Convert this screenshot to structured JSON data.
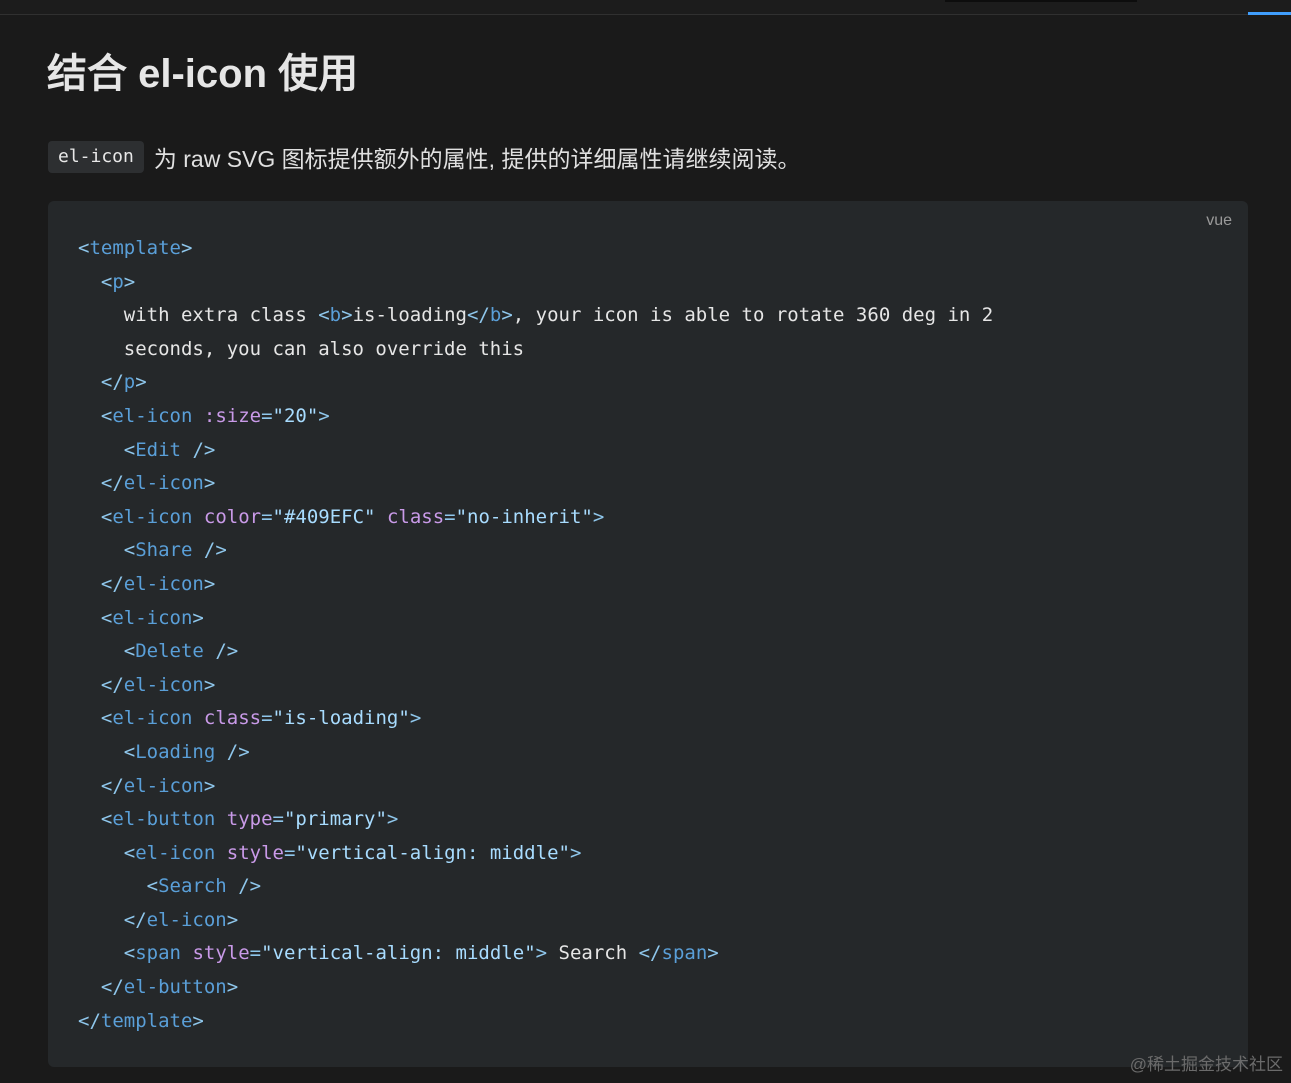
{
  "heading": "结合 el-icon 使用",
  "description": {
    "code": "el-icon",
    "text": "为 raw SVG 图标提供额外的属性, 提供的详细属性请继续阅读。"
  },
  "code_block": {
    "language": "vue",
    "lines": [
      [
        [
          "p",
          "<"
        ],
        [
          "t",
          "template"
        ],
        [
          "p",
          ">"
        ]
      ],
      [
        [
          "x",
          "  "
        ],
        [
          "p",
          "<"
        ],
        [
          "t",
          "p"
        ],
        [
          "p",
          ">"
        ]
      ],
      [
        [
          "x",
          "    with extra class "
        ],
        [
          "p",
          "<"
        ],
        [
          "t",
          "b"
        ],
        [
          "p",
          ">"
        ],
        [
          "x",
          "is-loading"
        ],
        [
          "p",
          "</"
        ],
        [
          "t",
          "b"
        ],
        [
          "p",
          ">"
        ],
        [
          "x",
          ", your icon is able to rotate 360 deg in 2"
        ]
      ],
      [
        [
          "x",
          "    seconds, you can also override this"
        ]
      ],
      [
        [
          "x",
          "  "
        ],
        [
          "p",
          "</"
        ],
        [
          "t",
          "p"
        ],
        [
          "p",
          ">"
        ]
      ],
      [
        [
          "x",
          "  "
        ],
        [
          "p",
          "<"
        ],
        [
          "t",
          "el-icon"
        ],
        [
          "x",
          " "
        ],
        [
          "a",
          ":size"
        ],
        [
          "p",
          "="
        ],
        [
          "s",
          "\"20\""
        ],
        [
          "p",
          ">"
        ]
      ],
      [
        [
          "x",
          "    "
        ],
        [
          "p",
          "<"
        ],
        [
          "t",
          "Edit"
        ],
        [
          "x",
          " "
        ],
        [
          "p",
          "/>"
        ]
      ],
      [
        [
          "x",
          "  "
        ],
        [
          "p",
          "</"
        ],
        [
          "t",
          "el-icon"
        ],
        [
          "p",
          ">"
        ]
      ],
      [
        [
          "x",
          "  "
        ],
        [
          "p",
          "<"
        ],
        [
          "t",
          "el-icon"
        ],
        [
          "x",
          " "
        ],
        [
          "a",
          "color"
        ],
        [
          "p",
          "="
        ],
        [
          "s",
          "\"#409EFC\""
        ],
        [
          "x",
          " "
        ],
        [
          "a",
          "class"
        ],
        [
          "p",
          "="
        ],
        [
          "s",
          "\"no-inherit\""
        ],
        [
          "p",
          ">"
        ]
      ],
      [
        [
          "x",
          "    "
        ],
        [
          "p",
          "<"
        ],
        [
          "t",
          "Share"
        ],
        [
          "x",
          " "
        ],
        [
          "p",
          "/>"
        ]
      ],
      [
        [
          "x",
          "  "
        ],
        [
          "p",
          "</"
        ],
        [
          "t",
          "el-icon"
        ],
        [
          "p",
          ">"
        ]
      ],
      [
        [
          "x",
          "  "
        ],
        [
          "p",
          "<"
        ],
        [
          "t",
          "el-icon"
        ],
        [
          "p",
          ">"
        ]
      ],
      [
        [
          "x",
          "    "
        ],
        [
          "p",
          "<"
        ],
        [
          "t",
          "Delete"
        ],
        [
          "x",
          " "
        ],
        [
          "p",
          "/>"
        ]
      ],
      [
        [
          "x",
          "  "
        ],
        [
          "p",
          "</"
        ],
        [
          "t",
          "el-icon"
        ],
        [
          "p",
          ">"
        ]
      ],
      [
        [
          "x",
          "  "
        ],
        [
          "p",
          "<"
        ],
        [
          "t",
          "el-icon"
        ],
        [
          "x",
          " "
        ],
        [
          "a",
          "class"
        ],
        [
          "p",
          "="
        ],
        [
          "s",
          "\"is-loading\""
        ],
        [
          "p",
          ">"
        ]
      ],
      [
        [
          "x",
          "    "
        ],
        [
          "p",
          "<"
        ],
        [
          "t",
          "Loading"
        ],
        [
          "x",
          " "
        ],
        [
          "p",
          "/>"
        ]
      ],
      [
        [
          "x",
          "  "
        ],
        [
          "p",
          "</"
        ],
        [
          "t",
          "el-icon"
        ],
        [
          "p",
          ">"
        ]
      ],
      [
        [
          "x",
          "  "
        ],
        [
          "p",
          "<"
        ],
        [
          "t",
          "el-button"
        ],
        [
          "x",
          " "
        ],
        [
          "a",
          "type"
        ],
        [
          "p",
          "="
        ],
        [
          "s",
          "\"primary\""
        ],
        [
          "p",
          ">"
        ]
      ],
      [
        [
          "x",
          "    "
        ],
        [
          "p",
          "<"
        ],
        [
          "t",
          "el-icon"
        ],
        [
          "x",
          " "
        ],
        [
          "a",
          "style"
        ],
        [
          "p",
          "="
        ],
        [
          "s",
          "\"vertical-align: middle\""
        ],
        [
          "p",
          ">"
        ]
      ],
      [
        [
          "x",
          "      "
        ],
        [
          "p",
          "<"
        ],
        [
          "t",
          "Search"
        ],
        [
          "x",
          " "
        ],
        [
          "p",
          "/>"
        ]
      ],
      [
        [
          "x",
          "    "
        ],
        [
          "p",
          "</"
        ],
        [
          "t",
          "el-icon"
        ],
        [
          "p",
          ">"
        ]
      ],
      [
        [
          "x",
          "    "
        ],
        [
          "p",
          "<"
        ],
        [
          "t",
          "span"
        ],
        [
          "x",
          " "
        ],
        [
          "a",
          "style"
        ],
        [
          "p",
          "="
        ],
        [
          "s",
          "\"vertical-align: middle\""
        ],
        [
          "p",
          ">"
        ],
        [
          "x",
          " Search "
        ],
        [
          "p",
          "</"
        ],
        [
          "t",
          "span"
        ],
        [
          "p",
          ">"
        ]
      ],
      [
        [
          "x",
          "  "
        ],
        [
          "p",
          "</"
        ],
        [
          "t",
          "el-button"
        ],
        [
          "p",
          ">"
        ]
      ],
      [
        [
          "p",
          "</"
        ],
        [
          "t",
          "template"
        ],
        [
          "p",
          ">"
        ]
      ]
    ]
  },
  "watermark": "@稀土掘金技术社区",
  "colors": {
    "background": "#1a1a1a",
    "code_background": "#25282a",
    "tag": "#5a9fd8",
    "punctuation": "#8fc7ec",
    "attribute": "#c99ae8",
    "string": "#a8dcff",
    "text": "#e6e6e6",
    "active_tab": "#409efc"
  }
}
